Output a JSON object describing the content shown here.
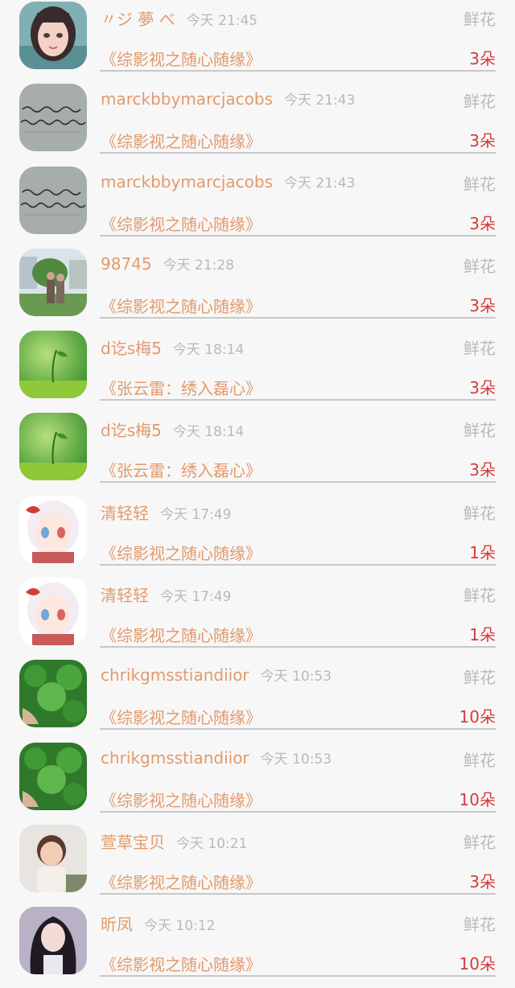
{
  "entries": [
    {
      "user": "〃ジ 夢 べ",
      "time": "今天 21:45",
      "gift": "鲜花",
      "book": "《综影视之随心随缘》",
      "count": "3朵",
      "avatar": "avatar-girl-pink"
    },
    {
      "user": "marckbbymarcjacobs",
      "time": "今天 21:43",
      "gift": "鲜花",
      "book": "《综影视之随心随缘》",
      "count": "3朵",
      "avatar": "avatar-handwriting"
    },
    {
      "user": "marckbbymarcjacobs",
      "time": "今天 21:43",
      "gift": "鲜花",
      "book": "《综影视之随心随缘》",
      "count": "3朵",
      "avatar": "avatar-handwriting"
    },
    {
      "user": "98745",
      "time": "今天 21:28",
      "gift": "鲜花",
      "book": "《综影视之随心随缘》",
      "count": "3朵",
      "avatar": "avatar-couple-outdoor"
    },
    {
      "user": "d讫s梅5",
      "time": "今天 18:14",
      "gift": "鲜花",
      "book": "《张云雷：绣入磊心》",
      "count": "3朵",
      "avatar": "avatar-green-sprout"
    },
    {
      "user": "d讫s梅5",
      "time": "今天 18:14",
      "gift": "鲜花",
      "book": "《张云雷：绣入磊心》",
      "count": "3朵",
      "avatar": "avatar-green-sprout"
    },
    {
      "user": "清轻轻",
      "time": "今天 17:49",
      "gift": "鲜花",
      "book": "《综影视之随心随缘》",
      "count": "1朵",
      "avatar": "avatar-anime-girl"
    },
    {
      "user": "清轻轻",
      "time": "今天 17:49",
      "gift": "鲜花",
      "book": "《综影视之随心随缘》",
      "count": "1朵",
      "avatar": "avatar-anime-girl"
    },
    {
      "user": "chrikgmsstiandiior",
      "time": "今天 10:53",
      "gift": "鲜花",
      "book": "《综影视之随心随缘》",
      "count": "10朵",
      "avatar": "avatar-clover"
    },
    {
      "user": "chrikgmsstiandiior",
      "time": "今天 10:53",
      "gift": "鲜花",
      "book": "《综影视之随心随缘》",
      "count": "10朵",
      "avatar": "avatar-clover"
    },
    {
      "user": "萱草宝贝",
      "time": "今天 10:21",
      "gift": "鲜花",
      "book": "《综影视之随心随缘》",
      "count": "3朵",
      "avatar": "avatar-child"
    },
    {
      "user": "昕凤",
      "time": "今天 10:12",
      "gift": "鲜花",
      "book": "《综影视之随心随缘》",
      "count": "10朵",
      "avatar": "avatar-dark-hair-girl"
    }
  ]
}
